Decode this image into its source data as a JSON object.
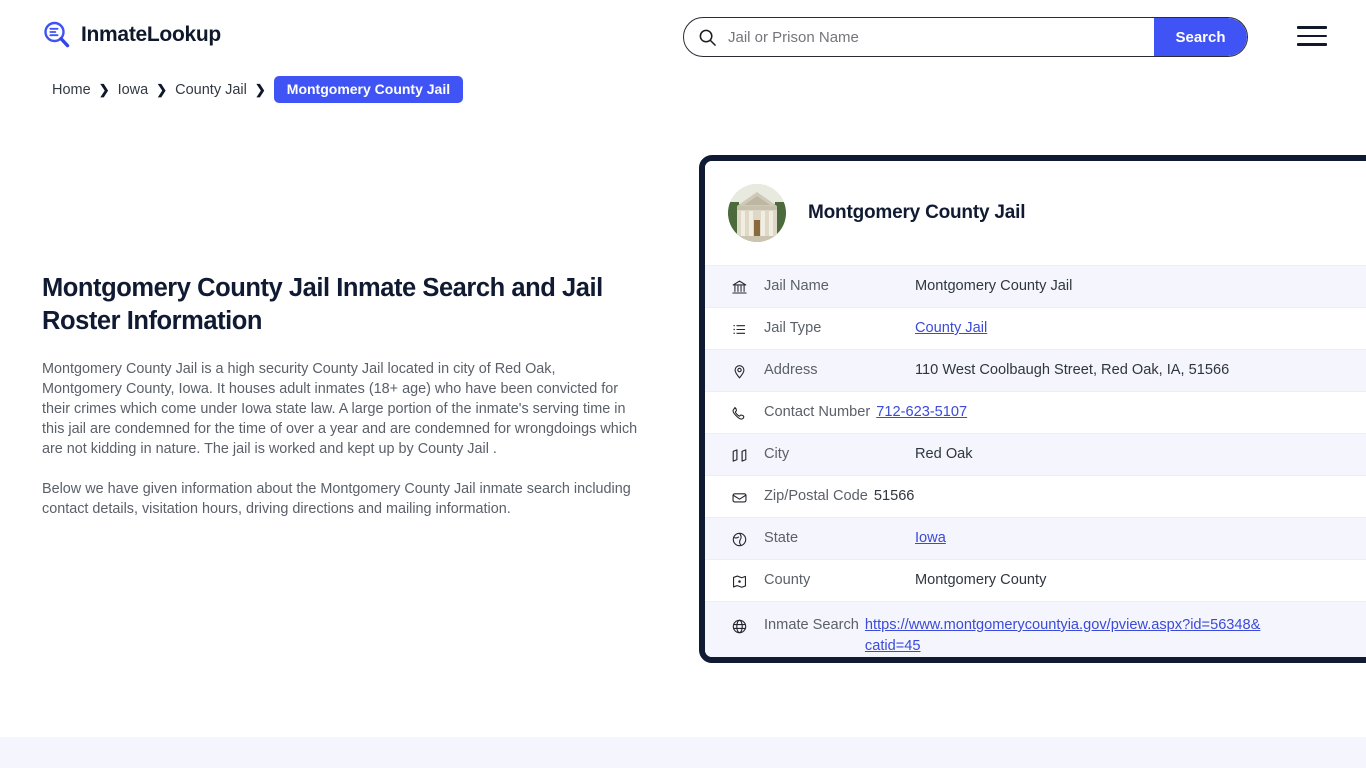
{
  "header": {
    "brand_name": "InmateLookup",
    "logo_icon": "magnifier-list-icon",
    "menu_icon": "hamburger-menu-icon"
  },
  "search": {
    "icon": "search-icon",
    "placeholder": "Jail or Prison Name",
    "value": "",
    "button_label": "Search"
  },
  "breadcrumb": {
    "items": [
      {
        "label": "Home",
        "current": false
      },
      {
        "label": "Iowa",
        "current": false
      },
      {
        "label": "County Jail",
        "current": false
      },
      {
        "label": "Montgomery County Jail",
        "current": true
      }
    ],
    "separator": "❯"
  },
  "main": {
    "title": "Montgomery County Jail Inmate Search and Jail Roster Information",
    "paragraphs": [
      "Montgomery County Jail is a high security County Jail located in city of Red Oak, Montgomery County, Iowa. It houses adult inmates (18+ age) who have been convicted for their crimes which come under Iowa state law. A large portion of the inmate's serving time in this jail are condemned for the time of over a year and are condemned for wrongdoings which are not kidding in nature. The jail is worked and kept up by County Jail .",
      "Below we have given information about the Montgomery County Jail inmate search including contact details, visitation hours, driving directions and mailing information."
    ]
  },
  "card": {
    "avatar_icon": "courthouse-photo",
    "title": "Montgomery County Jail",
    "rows": [
      {
        "icon": "bank-icon",
        "label": "Jail Name",
        "value": "Montgomery County Jail",
        "link": false
      },
      {
        "icon": "list-icon",
        "label": "Jail Type",
        "value": "County Jail",
        "link": true
      },
      {
        "icon": "map-pin-icon",
        "label": "Address",
        "value": "110 West Coolbaugh Street, Red Oak, IA, 51566",
        "link": false
      },
      {
        "icon": "phone-icon",
        "label": "Contact Number",
        "value": "712-623-5107",
        "link": true
      },
      {
        "icon": "map-icon",
        "label": "City",
        "value": "Red Oak",
        "link": false
      },
      {
        "icon": "envelope-icon",
        "label": "Zip/Postal Code",
        "value": "51566",
        "link": false
      },
      {
        "icon": "globe-pin-icon",
        "label": "State",
        "value": "Iowa",
        "link": true
      },
      {
        "icon": "county-icon",
        "label": "County",
        "value": "Montgomery County",
        "link": false
      },
      {
        "icon": "globe-icon",
        "label": "Inmate Search",
        "value": "https://www.montgomerycountyia.gov/pview.aspx?id=56348&catid=45",
        "link": true
      }
    ]
  },
  "colors": {
    "accent": "#4054f5",
    "navy": "#101a33",
    "link": "#3b4ad8",
    "row_alt": "#f5f6fd",
    "body_text": "#5b6069"
  }
}
